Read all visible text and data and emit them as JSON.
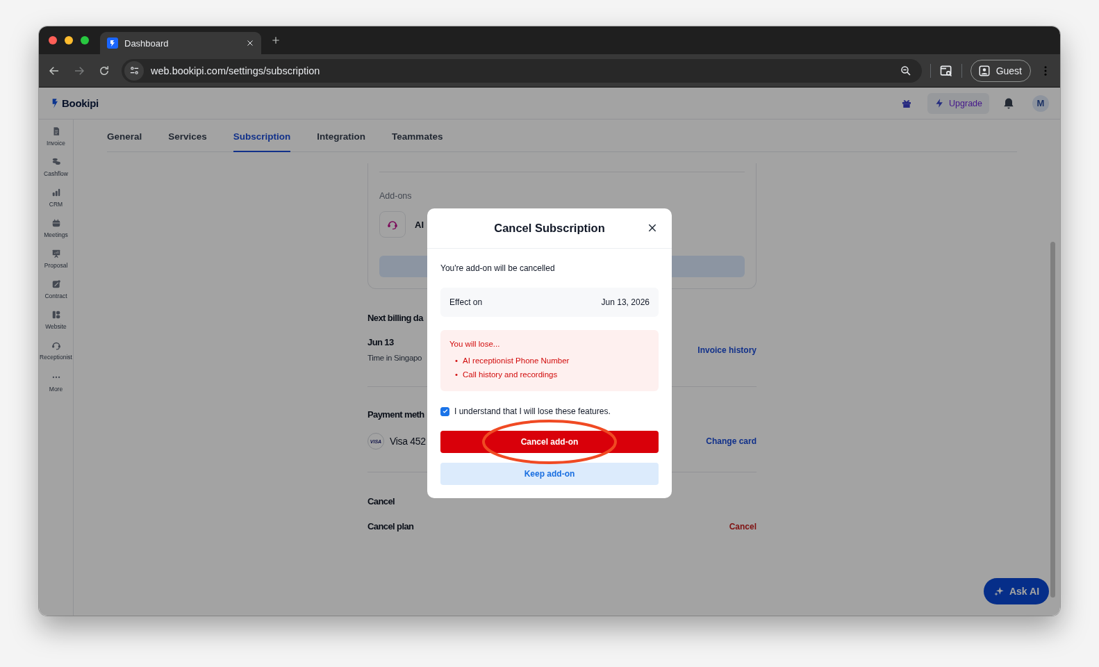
{
  "browser": {
    "tab_title": "Dashboard",
    "url": "web.bookipi.com/settings/subscription",
    "profile": "Guest"
  },
  "app_header": {
    "logo": "Bookipi",
    "upgrade": "Upgrade",
    "avatar": "M"
  },
  "sidebar": {
    "items": [
      {
        "label": "Invoice",
        "kind": "invoice"
      },
      {
        "label": "Cashflow",
        "kind": "cashflow"
      },
      {
        "label": "CRM",
        "kind": "crm"
      },
      {
        "label": "Meetings",
        "kind": "meetings"
      },
      {
        "label": "Proposal",
        "kind": "proposal"
      },
      {
        "label": "Contract",
        "kind": "contract"
      },
      {
        "label": "Website",
        "kind": "website"
      },
      {
        "label": "Receptionist",
        "kind": "receptionist"
      },
      {
        "label": "More",
        "kind": "more"
      }
    ]
  },
  "settings_tabs": [
    {
      "label": "General",
      "selected": false
    },
    {
      "label": "Services",
      "selected": false
    },
    {
      "label": "Subscription",
      "selected": true
    },
    {
      "label": "Integration",
      "selected": false
    },
    {
      "label": "Teammates",
      "selected": false
    }
  ],
  "addons": {
    "heading": "Add-ons",
    "name": "AI"
  },
  "billing": {
    "heading": "Next billing da",
    "date": "Jun 13",
    "timezone": "Time in Singapo",
    "link": "Invoice history"
  },
  "payment": {
    "heading": "Payment meth",
    "card_brand": "VISA",
    "card": "Visa 452",
    "link": "Change card"
  },
  "cancel": {
    "heading": "Cancel",
    "label": "Cancel plan",
    "link": "Cancel"
  },
  "ask_ai": "Ask AI",
  "dialog": {
    "title": "Cancel Subscription",
    "message": "You're add-on will be cancelled",
    "effect_label": "Effect on",
    "effect_date": "Jun 13, 2026",
    "lose_title": "You will lose...",
    "lose_items": [
      {
        "marker": "•",
        "text": "AI receptionist Phone Number"
      },
      {
        "marker": "•",
        "text": "Call history and recordings"
      }
    ],
    "confirm": {
      "label": "I understand that I will lose these features.",
      "checked": true
    },
    "primary": "Cancel add-on",
    "secondary": "Keep add-on"
  }
}
